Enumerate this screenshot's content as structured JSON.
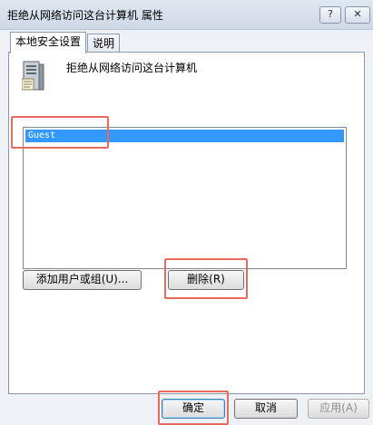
{
  "window": {
    "title": "拒绝从网络访问这台计算机 属性",
    "help_label": "?",
    "close_label": "✕"
  },
  "tabs": [
    {
      "label": "本地安全设置",
      "active": true
    },
    {
      "label": "说明",
      "active": false
    }
  ],
  "policy": {
    "icon": "server-icon",
    "title": "拒绝从网络访问这台计算机"
  },
  "list": {
    "items": [
      {
        "label": "Guest",
        "selected": true
      }
    ]
  },
  "buttons": {
    "add": "添加用户或组(U)...",
    "remove": "删除(R)",
    "ok": "确定",
    "cancel": "取消",
    "apply": "应用(A)"
  },
  "colors": {
    "selection": "#3399ff",
    "highlight_box": "#e86a5b"
  }
}
